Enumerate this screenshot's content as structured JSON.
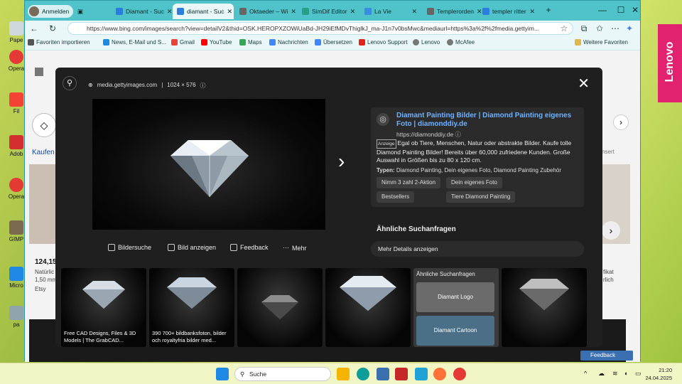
{
  "browser": {
    "profile": "Anmelden",
    "tabs": [
      {
        "label": "Diamant - Suc",
        "fav": "#2b7de0"
      },
      {
        "label": "diamant - Suc",
        "fav": "#2b7de0",
        "active": true
      },
      {
        "label": "Oktaeder – Wi",
        "fav": "#666666"
      },
      {
        "label": "SimDif Editor",
        "fav": "#2a9c8a"
      },
      {
        "label": "La Vie",
        "fav": "#3a8ee0"
      },
      {
        "label": "Templerorden",
        "fav": "#666666"
      },
      {
        "label": "templer ritter",
        "fav": "#2b7de0"
      }
    ],
    "url": "https://www.bing.com/images/search?view=detailV2&thid=OSK.HEROPXZOWiUaBd-JH29iEfMDvThiglkJ_ma-J1n7v0bsMwc&mediaurl=https%3a%2f%2fmedia.gettyim...",
    "favorites": [
      "Favoriten importieren",
      "News, E-Mail und S...",
      "Gmail",
      "YouTube",
      "Maps",
      "Nachrichten",
      "Übersetzen",
      "Lenovo Support",
      "Lenovo",
      "McAfee"
    ],
    "other_favorites": "Weitere Favoriten"
  },
  "viewer": {
    "source": "media.gettyimages.com",
    "size": "1024 × 576",
    "actions": [
      "Bildersuche",
      "Bild anzeigen",
      "Feedback",
      "Mehr"
    ],
    "ad": {
      "title": "Diamant Painting Bilder | Diamond Painting eigenes Foto | diamonddiy.de",
      "url": "https://diamonddiy.de",
      "badge": "Anzeige",
      "desc": "Egal ob Tiere, Menschen, Natur oder abstrakte Bilder. Kaufe tolle Diamond Painting Bilder! Bereits über 60,000 zufriedene Kunden. Große Auswahl in Größen bis zu 80 x 120 cm.",
      "types_label": "Typen:",
      "types": "Diamond Painting, Dein eigenes Foto, Diamond Painting Zubehör",
      "pills": [
        "Nimm 3 zahl 2-Aktion",
        "Dein eigenes Foto",
        "Bestsellers",
        "Tiere Diamond Painting"
      ]
    },
    "similar_heading": "Ähnliche Suchanfragen",
    "more_details": "Mehr Details anzeigen",
    "thumbs": [
      {
        "caption": "Free CAD Designs, Files & 3D Models | The GrabCAD..."
      },
      {
        "caption": "390 700+ bildbanksfoton, bilder och royaltyfria bilder med..."
      },
      {
        "caption": ""
      },
      {
        "caption": ""
      }
    ],
    "similar_box": {
      "heading": "Ähnliche Suchanfragen",
      "items": [
        "Diamant Logo",
        "Diamant Cartoon"
      ]
    }
  },
  "background_page": {
    "price": "124,15",
    "vendor": "Etsy",
    "text1": "Natürlic",
    "text2": "1,50 mm",
    "heading": "Kaufen",
    "right_label": "nsert",
    "right_text": "fikat",
    "right_text2": "rlich",
    "feedback": "Feedback"
  },
  "desktop_icons": [
    "Pape",
    "Opera",
    "Fil",
    "Adob",
    "Opera",
    "GIMP",
    "Micro",
    "pa"
  ],
  "brand": "Lenovo",
  "taskbar": {
    "search": "Suche",
    "time": "21:20",
    "date": "24.04.2025"
  }
}
